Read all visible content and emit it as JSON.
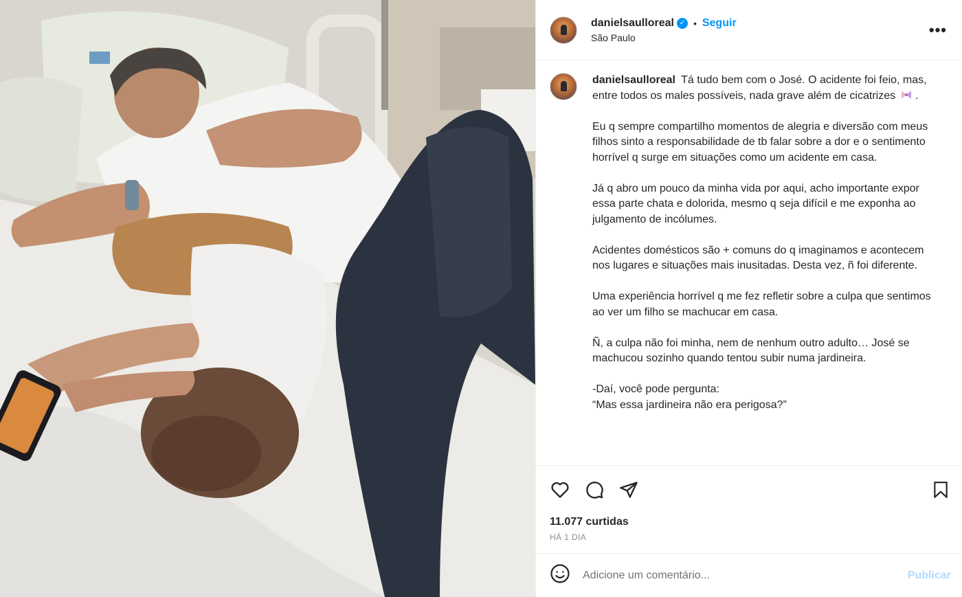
{
  "post": {
    "photo_alt_icon": "post-photo",
    "author": {
      "username": "danielsaulloreal",
      "verified_icon": "verified-badge-icon",
      "follow_label": "Seguir",
      "separator": "•",
      "location": "São Paulo"
    },
    "more_label": "•••",
    "caption": {
      "username": "danielsaulloreal",
      "paragraphs": [
        "Tá tudo bem com o José. O acidente foi feio, mas, entre todos os males possíveis, nada grave além de cicatrizes",
        "Eu q sempre compartilho momentos de alegria e diversão com meus filhos sinto a responsabilidade de tb falar sobre a dor e o sentimento horrível q surge em situações como um acidente em casa.",
        "Já q abro um pouco da minha vida por aqui, acho importante expor essa parte chata e dolorida, mesmo q seja difícil e me exponha ao julgamento de incólumes.",
        "Acidentes domésticos são + comuns do q imaginamos e acontecem nos lugares e situações mais inusitadas. Desta vez, ñ foi diferente.",
        "Uma experiência horrível q me fez refletir sobre a culpa que sentimos ao ver um filho se machucar em casa.",
        "Ñ, a culpa não foi minha, nem de nenhum outro adulto… José se machucou sozinho quando tentou subir numa jardineira.",
        "-Daí, você pode pergunta:",
        "“Mas essa jardineira não era perigosa?”"
      ],
      "first_paragraph_suffix": " ."
    },
    "likes": "11.077 curtidas",
    "time": "HÁ 1 DIA",
    "comment": {
      "placeholder": "Adicione um comentário...",
      "publish_label": "Publicar"
    },
    "colors": {
      "accent": "#0095f6",
      "publish_disabled": "#b3dbff",
      "border": "#efefef"
    }
  }
}
